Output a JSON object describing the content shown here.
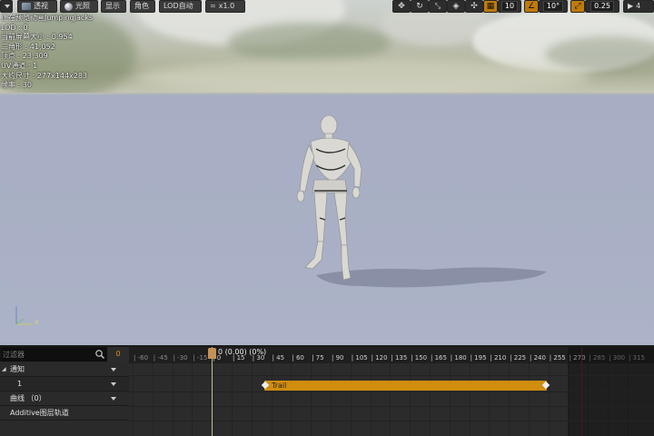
{
  "toolbar": {
    "perspective_label": "透视",
    "lit_label": "光照",
    "show_label": "显示",
    "character_label": "角色",
    "lod_label": "LOD自动",
    "speed_label": "x1.0",
    "grid_snap_value": "10",
    "rotation_snap_value": "10°",
    "scale_snap_value": "0.25",
    "camera_speed_value": "4"
  },
  "stats": {
    "line1": "正在预览动画JumpingJacks",
    "line2": "LOD : 0",
    "line3": "当前屏幕大小 : 0.954",
    "line4": "三角形 : 41,052",
    "line5": "顶点 : 23,309",
    "line6": "UV通道 : 1",
    "line7": "大约尺寸 : 277x144x283",
    "line8": "帧率 : 30"
  },
  "gizmo": {
    "x_label": "x"
  },
  "tracks_panel": {
    "filter_placeholder": "过滤器",
    "count": "0",
    "rows": [
      {
        "label": "通知"
      },
      {
        "label": "1"
      },
      {
        "label": "曲线 （0）"
      },
      {
        "label": "Additive图层轨道"
      }
    ]
  },
  "timeline": {
    "playhead_label": "0 (0.00) (0%)",
    "ticks": [
      "-60",
      "-45",
      "-30",
      "-15",
      "0",
      "15",
      "30",
      "45",
      "60",
      "75",
      "90",
      "105",
      "120",
      "135",
      "150",
      "165",
      "180",
      "195",
      "210",
      "225",
      "240",
      "255",
      "270",
      "285",
      "300",
      "315"
    ],
    "notify_name": "Trail"
  },
  "colors": {
    "accent": "#d08d0e",
    "floor": "#a9b0c5",
    "panel": "#2a2a2a"
  }
}
